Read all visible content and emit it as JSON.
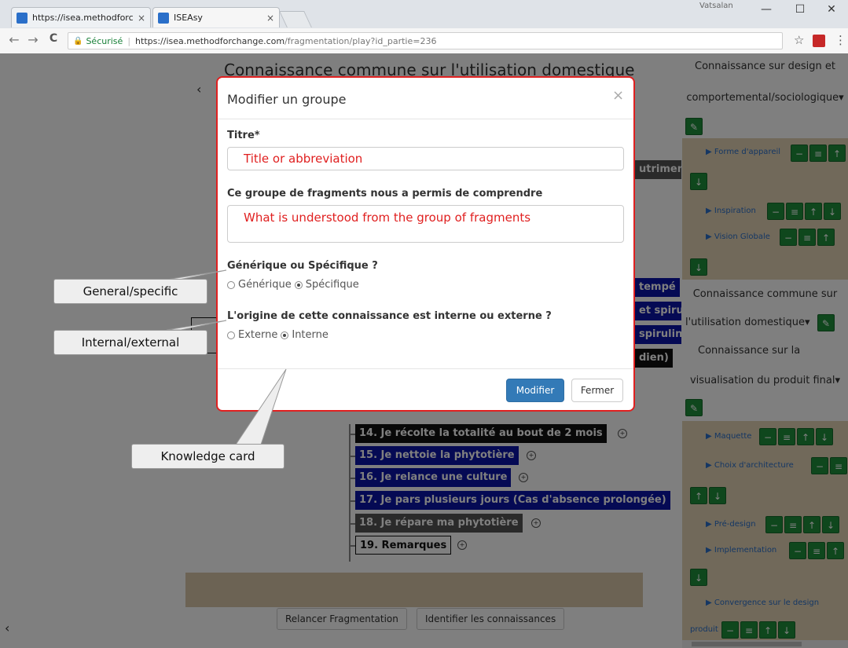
{
  "browser": {
    "tabs": [
      {
        "title": "https://isea.methodforch"
      },
      {
        "title": "ISEAsy"
      }
    ],
    "profile_name": "Vatsalan",
    "window_controls": {
      "minimize": "—",
      "maximize": "☐",
      "close": "✕"
    },
    "nav": {
      "back": "←",
      "forward": "→",
      "reload": "C"
    },
    "secure_label": "Sécurisé",
    "url_host": "https://isea.methodforchange.com",
    "url_path": "/fragmentation/play?id_partie=236",
    "star": "☆",
    "menu": "⋮"
  },
  "page": {
    "title": "Connaissance commune sur l'utilisation domestique",
    "prev_arrow": "‹",
    "bottom_left_arrow": "‹",
    "partial_chips": [
      {
        "text": "utrimen",
        "style": "gray"
      },
      {
        "text": "tempé",
        "style": "blue"
      },
      {
        "text": "et spiru",
        "style": "blue"
      },
      {
        "text": "spiruline",
        "style": "blue"
      },
      {
        "text": "dien)",
        "style": "black"
      }
    ],
    "fragments": [
      {
        "text": "14. Je récolte la totalité au bout de 2 mois",
        "style": "black"
      },
      {
        "text": "15. Je nettoie la phytotière",
        "style": "blue"
      },
      {
        "text": "16. Je relance une culture",
        "style": "blue"
      },
      {
        "text": "17. Je pars plusieurs jours (Cas d'absence prolongée)",
        "style": "blue"
      },
      {
        "text": "18. Je répare ma phytotière",
        "style": "gray"
      },
      {
        "text": "19. Remarques",
        "style": "white"
      }
    ],
    "buttons": {
      "relancer": "Relancer Fragmentation",
      "identifier": "Identifier les connaissances"
    }
  },
  "sidebar": {
    "groups": [
      {
        "title_line1": "Connaissance sur design et",
        "title_line2": "comportemental/sociologique▾"
      },
      {
        "title_line1": "Connaissance commune sur",
        "title_line2": "l'utilisation domestique▾"
      },
      {
        "title_line1": "Connaissance sur la",
        "title_line2": "visualisation du produit final▾"
      }
    ],
    "items_group1": [
      "▶ Forme d'appareil",
      "▶ Inspiration",
      "▶ Vision Globale"
    ],
    "items_group3": [
      "▶ Maquette",
      "▶ Choix d'architecture",
      "▶ Pré-design",
      "▶ Implementation",
      "▶ Convergence sur le design",
      "produit"
    ],
    "icons": {
      "edit": "✎",
      "minus": "−",
      "list": "≡",
      "up": "↑",
      "down": "↓"
    }
  },
  "modal": {
    "title": "Modifier un groupe",
    "close": "×",
    "titre_label": "Titre*",
    "titre_value": "Title or abbreviation",
    "comprendre_label": "Ce groupe de fragments nous a permis de comprendre",
    "comprendre_value": "What is understood from the group of fragments",
    "generique_question": "Générique ou Spécifique ?",
    "generique_options": [
      "Générique",
      "Spécifique"
    ],
    "generique_selected": "Spécifique",
    "origine_question": "L'origine de cette connaissance est interne ou externe ?",
    "origine_options": [
      "Externe",
      "Interne"
    ],
    "origine_selected": "Interne",
    "btn_modifier": "Modifier",
    "btn_fermer": "Fermer"
  },
  "annotations": {
    "general_specific": "General/specific",
    "internal_external": "Internal/external",
    "knowledge_card": "Knowledge card"
  },
  "colors": {
    "modal_border": "#e02020",
    "primary_button": "#337ab7",
    "green_button": "#1e8f3b",
    "chip_blue": "#0a14a8"
  }
}
